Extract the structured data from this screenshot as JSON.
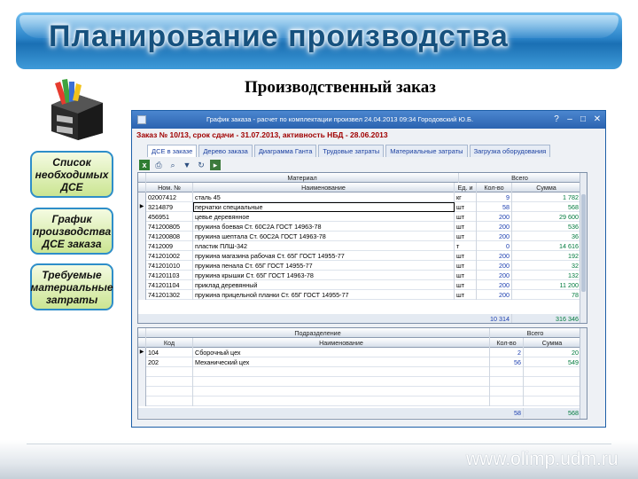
{
  "banner": {
    "title": "Планирование производства"
  },
  "slide": {
    "subtitle": "Производственный заказ",
    "site": "www.olimp.udm.ru"
  },
  "side_buttons": [
    {
      "label": "Список\nнеобходимых\nДСЕ"
    },
    {
      "label": "График\nпроизводства\nДСЕ заказа"
    },
    {
      "label": "Требуемые\nматериальные\nзатраты"
    }
  ],
  "window": {
    "title": "График заказа - расчет по комплектации произвел 24.04.2013 09:34  Городовский Ю.Б.",
    "controls": {
      "help": "?",
      "minimize": "–",
      "maximize": "□",
      "close": "✕"
    }
  },
  "order": {
    "header": "Заказ № 10/13,   срок сдачи - 31.07.2013,   активность НБД - 28.06.2013"
  },
  "tabs": [
    "ДСЕ в заказе",
    "Дерево заказа",
    "Диаграмма Ганта",
    "Трудовые затраты",
    "Материальные затраты",
    "Загрузка оборудования"
  ],
  "toolbar_icons": [
    "excel-icon",
    "print-icon",
    "search-icon",
    "filter-icon",
    "refresh-icon",
    "exit-icon"
  ],
  "materials": {
    "group_material": "Материал",
    "group_total": "Всего",
    "columns": [
      "Ном. №",
      "Наименование",
      "Ед. и",
      "Кол-во",
      "Сумма"
    ],
    "rows": [
      [
        "02007412",
        "сталь 45",
        "кг",
        "9",
        "1 782"
      ],
      [
        "3214879",
        "перчатки специальные",
        "шт",
        "58",
        "568"
      ],
      [
        "456951",
        "цевье деревянное",
        "шт",
        "200",
        "29 600"
      ],
      [
        "741200805",
        "пружина боевая Ст. 60С2А ГОСТ 14963-78",
        "шт",
        "200",
        "536"
      ],
      [
        "741200808",
        "пружина шептала Ст. 60С2А ГОСТ 14963-78",
        "шт",
        "200",
        "36"
      ],
      [
        "7412009",
        "пластик ПЛШ-342",
        "т",
        "0",
        "14 616"
      ],
      [
        "741201002",
        "пружина магазина рабочая Ст. 65Г ГОСТ 14955-77",
        "шт",
        "200",
        "192"
      ],
      [
        "741201010",
        "пружина пенала Ст. 65Г ГОСТ 14955-77",
        "шт",
        "200",
        "32"
      ],
      [
        "741201103",
        "пружина крышки Ст. 65Г ГОСТ 14963-78",
        "шт",
        "200",
        "132"
      ],
      [
        "741201104",
        "приклад деревянный",
        "шт",
        "200",
        "11 200"
      ],
      [
        "741201302",
        "пружина прицельной планки Ст. 65Г ГОСТ 14955-77",
        "шт",
        "200",
        "78"
      ]
    ],
    "totals": {
      "qty": "10 314",
      "sum": "316 346"
    }
  },
  "departments": {
    "group_dept": "Подразделение",
    "group_total": "Всего",
    "columns": [
      "Код",
      "Наименование",
      "Кол-во",
      "Сумма"
    ],
    "rows": [
      [
        "104",
        "Сборочный цех",
        "2",
        "20"
      ],
      [
        "202",
        "Механический цех",
        "56",
        "549"
      ]
    ],
    "totals": {
      "qty": "58",
      "sum": "568"
    }
  }
}
